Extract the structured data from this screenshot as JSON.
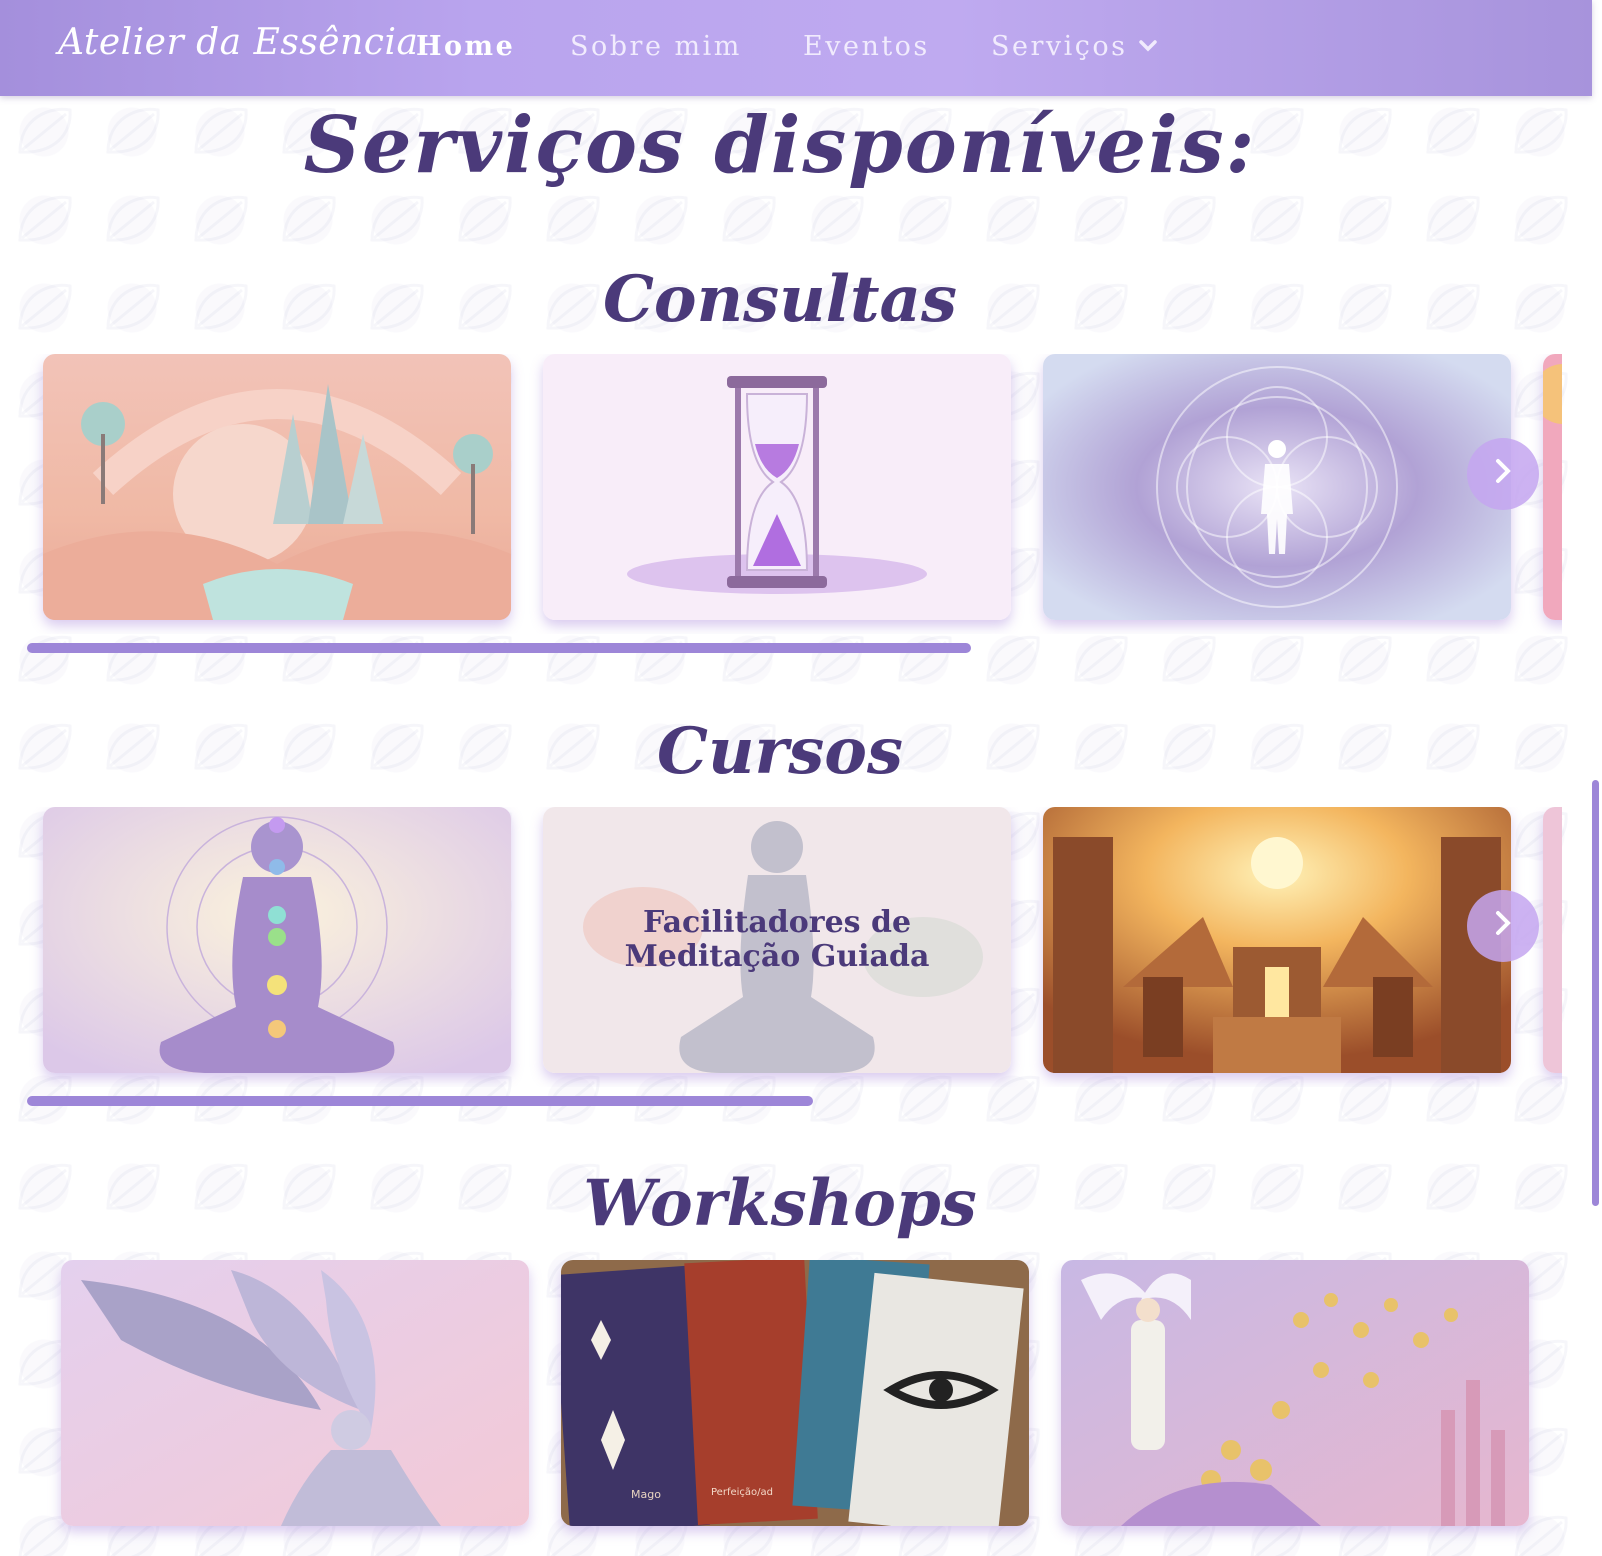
{
  "nav": {
    "brand": "Atelier da Essência",
    "links": [
      "Home",
      "Sobre mim",
      "Eventos",
      "Serviços"
    ],
    "dropdown_icon": "chevron-down-icon"
  },
  "page": {
    "title": "Serviços disponíveis:"
  },
  "sections": [
    {
      "title": "Consultas"
    },
    {
      "title": "Cursos",
      "card_text": "Facilitadores de Meditação Guiada"
    },
    {
      "title": "Workshops"
    }
  ],
  "cards": {
    "workshop_card2_labels": [
      "Mago",
      "Perfeição/ad"
    ]
  },
  "icons": {
    "next": "chevron-right-icon"
  },
  "colors": {
    "nav_gradient": "#b9a4ee",
    "heading": "#4b3a7a",
    "accent": "#9d86d8"
  }
}
